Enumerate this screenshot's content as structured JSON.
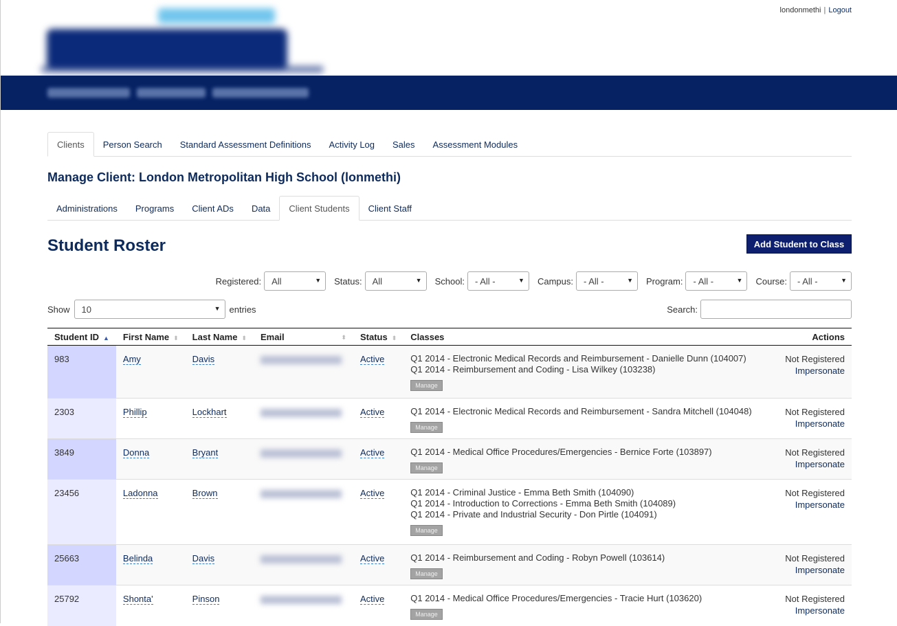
{
  "user": {
    "name": "londonmethi",
    "separator": "|",
    "logout": "Logout"
  },
  "main_tabs": [
    "Clients",
    "Person Search",
    "Standard Assessment Definitions",
    "Activity Log",
    "Sales",
    "Assessment Modules"
  ],
  "client_title": "Manage Client: London Metropolitan High School (lonmethi)",
  "sub_tabs": [
    "Administrations",
    "Programs",
    "Client ADs",
    "Data",
    "Client Students",
    "Client Staff"
  ],
  "roster": {
    "title": "Student Roster",
    "add_button": "Add Student to Class",
    "filters": [
      {
        "label": "Registered:",
        "value": "All"
      },
      {
        "label": "Status:",
        "value": "All"
      },
      {
        "label": "School:",
        "value": "- All -"
      },
      {
        "label": "Campus:",
        "value": "- All -"
      },
      {
        "label": "Program:",
        "value": "- All -"
      },
      {
        "label": "Course:",
        "value": "- All -"
      }
    ],
    "show_label": "Show",
    "show_value": "10",
    "entries_label": "entries",
    "search_label": "Search:",
    "search_value": "",
    "columns": [
      "Student ID",
      "First Name",
      "Last Name",
      "Email",
      "Status",
      "Classes",
      "Actions"
    ],
    "manage_label": "Manage",
    "rows": [
      {
        "id": "983",
        "first": "Amy",
        "last": "Davis",
        "status": "Active",
        "classes": [
          "Q1 2014 - Electronic Medical Records and Reimbursement - Danielle Dunn (104007)",
          "Q1 2014 - Reimbursement and Coding - Lisa Wilkey (103238)"
        ],
        "registration": "Not Registered",
        "action": "Impersonate"
      },
      {
        "id": "2303",
        "first": "Phillip",
        "last": "Lockhart",
        "status": "Active",
        "classes": [
          "Q1 2014 - Electronic Medical Records and Reimbursement - Sandra Mitchell (104048)"
        ],
        "registration": "Not Registered",
        "action": "Impersonate"
      },
      {
        "id": "3849",
        "first": "Donna",
        "last": "Bryant",
        "status": "Active",
        "classes": [
          "Q1 2014 - Medical Office Procedures/Emergencies - Bernice Forte (103897)"
        ],
        "registration": "Not Registered",
        "action": "Impersonate"
      },
      {
        "id": "23456",
        "first": "Ladonna",
        "last": "Brown",
        "status": "Active",
        "classes": [
          "Q1 2014 - Criminal Justice - Emma Beth Smith (104090)",
          "Q1 2014 - Introduction to Corrections - Emma Beth Smith (104089)",
          "Q1 2014 - Private and Industrial Security - Don Pirtle (104091)"
        ],
        "registration": "Not Registered",
        "action": "Impersonate"
      },
      {
        "id": "25663",
        "first": "Belinda",
        "last": "Davis",
        "status": "Active",
        "classes": [
          "Q1 2014 - Reimbursement and Coding - Robyn Powell (103614)"
        ],
        "registration": "Not Registered",
        "action": "Impersonate"
      },
      {
        "id": "25792",
        "first": "Shonta'",
        "last": "Pinson",
        "status": "Active",
        "classes": [
          "Q1 2014 - Medical Office Procedures/Emergencies - Tracie Hurt (103620)"
        ],
        "registration": "Not Registered",
        "action": "Impersonate"
      }
    ]
  }
}
